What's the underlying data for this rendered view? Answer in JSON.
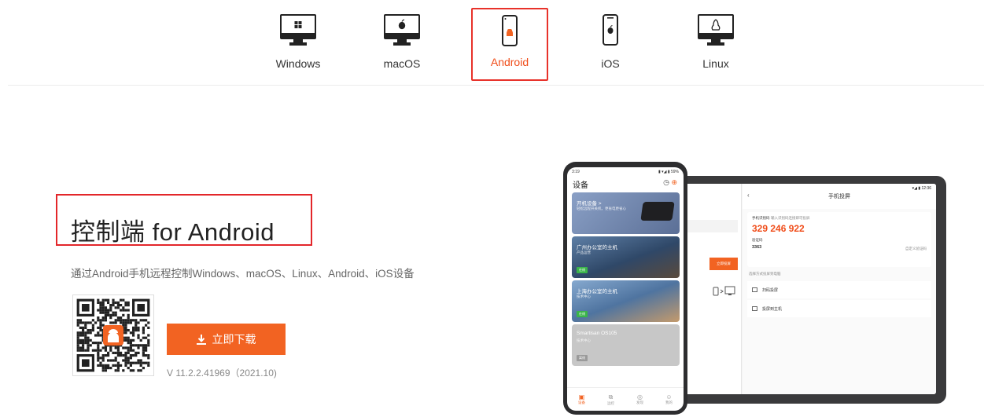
{
  "os_tabs": [
    {
      "label": "Windows",
      "icon": "monitor-windows-icon"
    },
    {
      "label": "macOS",
      "icon": "monitor-apple-icon"
    },
    {
      "label": "Android",
      "icon": "phone-android-icon",
      "active": true
    },
    {
      "label": "iOS",
      "icon": "phone-apple-icon"
    },
    {
      "label": "Linux",
      "icon": "monitor-linux-icon"
    }
  ],
  "hero": {
    "title": "控制端 for Android",
    "subtitle": "通过Android手机远程控制Windows、macOS、Linux、Android、iOS设备",
    "download_label": "立即下载",
    "version": "V 11.2.2.41969（2021.10)"
  },
  "phone": {
    "status_time": "3:19",
    "status_right": "▮ ▾◢ ▮ 59%",
    "title": "设备",
    "cards": [
      {
        "title": "开机设备 >",
        "sub": "轻松远程开关机，更省电更省心"
      },
      {
        "title": "广州办公室的主机",
        "sub": "产品运营",
        "badge": "在线"
      },
      {
        "title": "上海办公室的主机",
        "sub": "技术中心",
        "badge": "在线"
      },
      {
        "title": "Smartisan OS105",
        "sub": "技术中心",
        "badge": "离线"
      }
    ],
    "nav": [
      "设备",
      "远控",
      "发现",
      "我的"
    ]
  },
  "tablet": {
    "status": "▾◢ ▮ 12:36",
    "header": "手机投屏",
    "code_label": "手机识别码",
    "code_hint": "输入识别码连接即可投屏",
    "code": "329 246 922",
    "pw_label": "验证码",
    "pw": "3363",
    "pw_action": "自定义验证码",
    "section": "选择方式投屏到电脑",
    "rows": [
      "扫码投屏",
      "投屏到主机"
    ],
    "left_button": "立即投屏"
  },
  "colors": {
    "accent": "#f26322",
    "highlight_box": "#e3262a"
  }
}
